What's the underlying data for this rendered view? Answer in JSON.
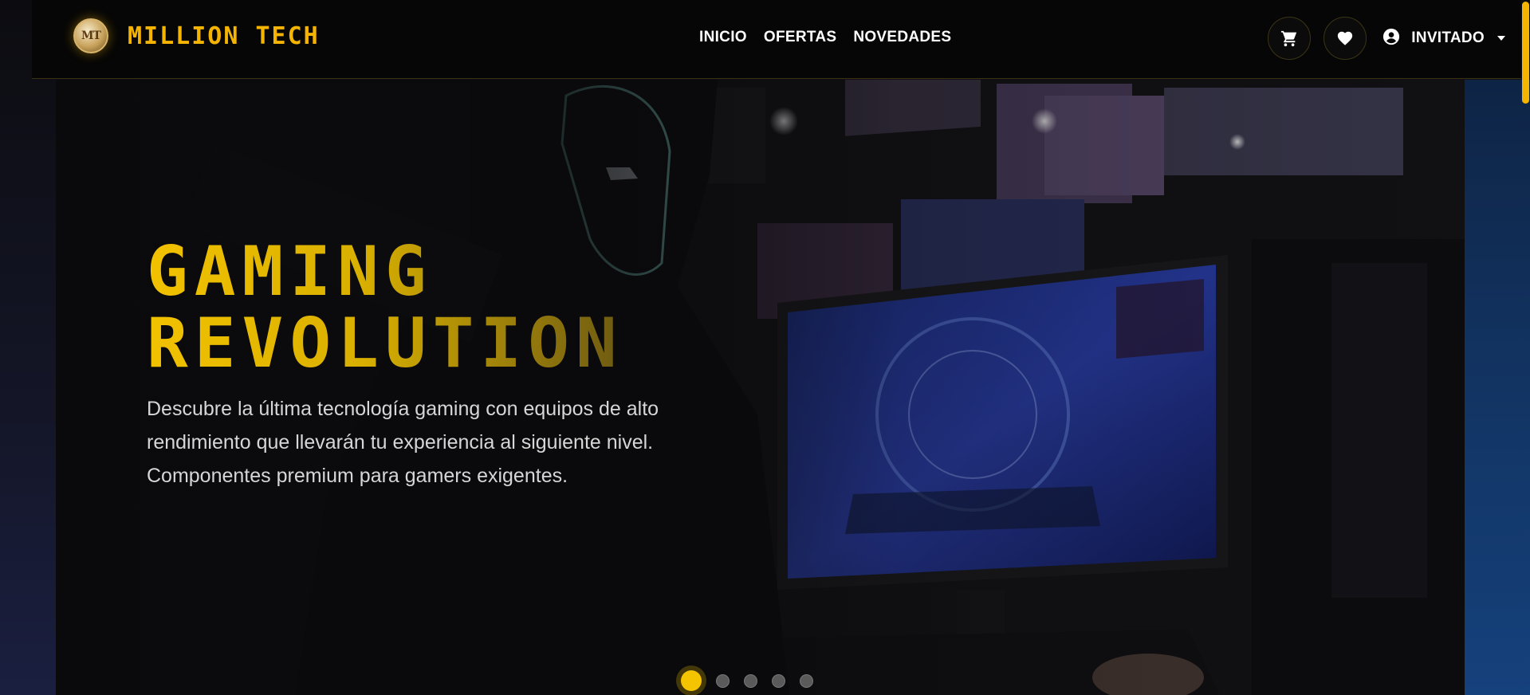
{
  "brand": {
    "name": "MILLION TECH",
    "logo_text": "MT"
  },
  "nav": {
    "links": [
      "INICIO",
      "OFERTAS",
      "NOVEDADES"
    ]
  },
  "actions": {
    "cart_icon": "cart-icon",
    "wishlist_icon": "heart-icon",
    "user_icon": "user-circle-icon",
    "user_label": "INVITADO"
  },
  "hero": {
    "title_line1": "GAMING",
    "title_line2": "REVOLUTION",
    "description": "Descubre la última tecnología gaming con equipos de alto rendimiento que llevarán tu experiencia al siguiente nivel. Componentes premium para gamers exigentes.",
    "slides_total": 5,
    "active_slide": 1
  },
  "colors": {
    "accent": "#f4b400",
    "title_gold": "#f2c200",
    "navbar_bg": "#060606",
    "text_light": "#d6d6d6"
  }
}
